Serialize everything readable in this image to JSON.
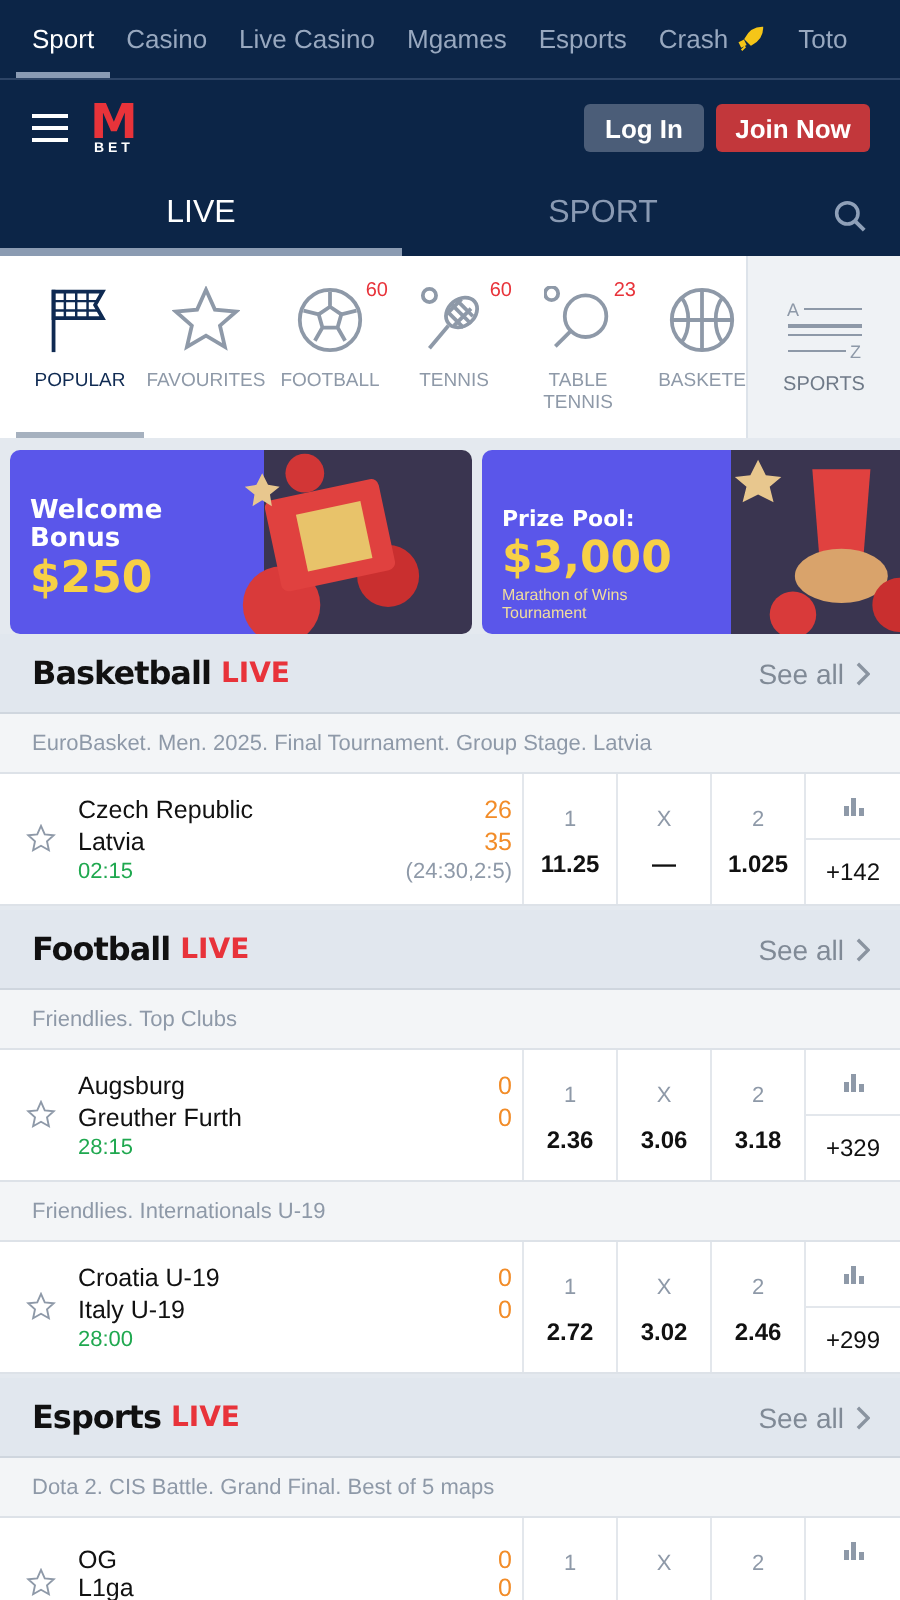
{
  "top_nav": [
    {
      "label": "Sport",
      "selected": true,
      "kind": "plain"
    },
    {
      "label": "Casino",
      "selected": false,
      "kind": "plain"
    },
    {
      "label": "Live Casino",
      "selected": false,
      "kind": "plain"
    },
    {
      "label": "Mgames",
      "selected": false,
      "kind": "plain"
    },
    {
      "label": "Esports",
      "selected": false,
      "kind": "plain"
    },
    {
      "label": "Crash",
      "selected": false,
      "kind": "rocket"
    },
    {
      "label": "Toto",
      "selected": false,
      "kind": "plain"
    }
  ],
  "header": {
    "logo_letter": "M",
    "logo_sub": "BET",
    "login": "Log In",
    "join": "Join Now"
  },
  "tabs": [
    {
      "label": "LIVE",
      "selected": true
    },
    {
      "label": "SPORT",
      "selected": false
    }
  ],
  "sports": [
    {
      "label": "POPULAR",
      "kind": "flag",
      "selected": true
    },
    {
      "label": "FAVOURITES",
      "kind": "star",
      "selected": false
    },
    {
      "label": "FOOTBALL",
      "kind": "ball",
      "count": "60",
      "selected": false
    },
    {
      "label": "TENNIS",
      "kind": "racket",
      "count": "60",
      "selected": false
    },
    {
      "label": "TABLE TENNIS",
      "kind": "paddle",
      "count": "23",
      "selected": false
    },
    {
      "label": "BASKETE",
      "kind": "basket",
      "selected": false
    }
  ],
  "sports_button": {
    "label": "SPORTS",
    "letter_top": "A",
    "letter_bottom": "Z"
  },
  "banners": [
    {
      "kind": "welcome",
      "title": "Welcome Bonus",
      "amount": "$250"
    },
    {
      "kind": "prize",
      "title": "Prize Pool:",
      "amount": "$3,000",
      "subtitle": "Marathon of Wins Tournament"
    }
  ],
  "sections": [
    {
      "title": "Basketball",
      "live": "LIVE",
      "see_all": "See all",
      "leagues": [
        {
          "name": "EuroBasket. Men. 2025. Final Tournament. Group Stage. Latvia",
          "matches": [
            {
              "team1": "Czech Republic",
              "team2": "Latvia",
              "score1": "26",
              "score2": "35",
              "time": "02:15",
              "detail": "(24:30,2:5)",
              "odds": [
                {
                  "label": "1",
                  "value": "11.25"
                },
                {
                  "label": "X",
                  "value": "—"
                },
                {
                  "label": "2",
                  "value": "1.025"
                }
              ],
              "more": "+142"
            }
          ]
        }
      ]
    },
    {
      "title": "Football",
      "live": "LIVE",
      "see_all": "See all",
      "leagues": [
        {
          "name": "Friendlies. Top Clubs",
          "matches": [
            {
              "team1": "Augsburg",
              "team2": "Greuther Furth",
              "score1": "0",
              "score2": "0",
              "time": "28:15",
              "odds": [
                {
                  "label": "1",
                  "value": "2.36"
                },
                {
                  "label": "X",
                  "value": "3.06"
                },
                {
                  "label": "2",
                  "value": "3.18"
                }
              ],
              "more": "+329"
            }
          ]
        },
        {
          "name": "Friendlies. Internationals U-19",
          "matches": [
            {
              "team1": "Croatia U-19",
              "team2": "Italy U-19",
              "score1": "0",
              "score2": "0",
              "time": "28:00",
              "odds": [
                {
                  "label": "1",
                  "value": "2.72"
                },
                {
                  "label": "X",
                  "value": "3.02"
                },
                {
                  "label": "2",
                  "value": "2.46"
                }
              ],
              "more": "+299"
            }
          ]
        }
      ]
    },
    {
      "title": "Esports",
      "live": "LIVE",
      "see_all": "See all",
      "leagues": [
        {
          "name": "Dota 2. CIS Battle. Grand Final. Best of 5 maps",
          "matches": [
            {
              "team1": "OG",
              "team2": "L1ga",
              "score1": "0",
              "score2": "0",
              "odds": [
                {
                  "label": "1"
                },
                {
                  "label": "X"
                },
                {
                  "label": "2"
                }
              ]
            }
          ]
        }
      ]
    }
  ]
}
